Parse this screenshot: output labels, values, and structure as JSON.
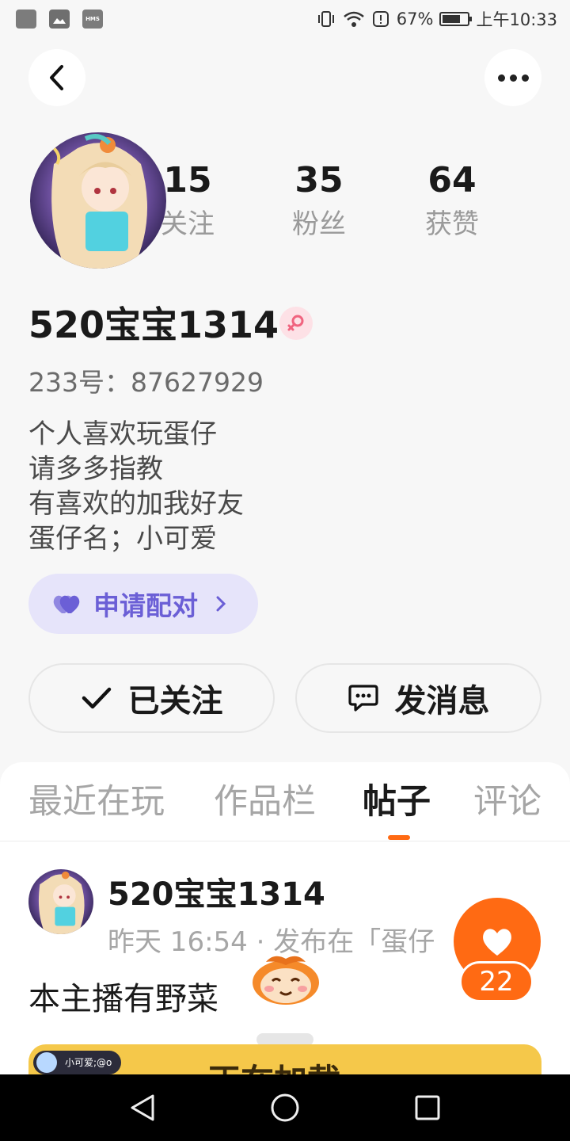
{
  "status_bar": {
    "left_icons": [
      "square-icon",
      "image-icon",
      "hms-icon"
    ],
    "hms_text": "HMS",
    "battery_percent": "67%",
    "time": "上午10:33"
  },
  "profile": {
    "stats": [
      {
        "value": "15",
        "label": "关注"
      },
      {
        "value": "35",
        "label": "粉丝"
      },
      {
        "value": "64",
        "label": "获赞"
      }
    ],
    "username": "520宝宝1314",
    "uid": "233号：87627929",
    "bio_lines": [
      "个人喜欢玩蛋仔",
      "请多多指教",
      "有喜欢的加我好友",
      "蛋仔名；小可爱"
    ],
    "pair_label": "申请配对",
    "follow_label": "已关注",
    "message_label": "发消息"
  },
  "tabs": [
    {
      "label": "最近在玩",
      "active": false
    },
    {
      "label": "作品栏",
      "active": false
    },
    {
      "label": "帖子",
      "active": true
    },
    {
      "label": "评论",
      "active": false
    }
  ],
  "post": {
    "author": "520宝宝1314",
    "meta": "昨天 16:54 · 发布在「蛋仔",
    "text": "本主播有野菜",
    "banner_chip": "小可爱;@o",
    "banner_title": "正在加载",
    "like_count": "22"
  },
  "colors": {
    "accent": "#ff6a13",
    "pair_bg": "#e6e4fa",
    "pair_text": "#6b5fd6",
    "gender_bg": "#fde1e6"
  }
}
